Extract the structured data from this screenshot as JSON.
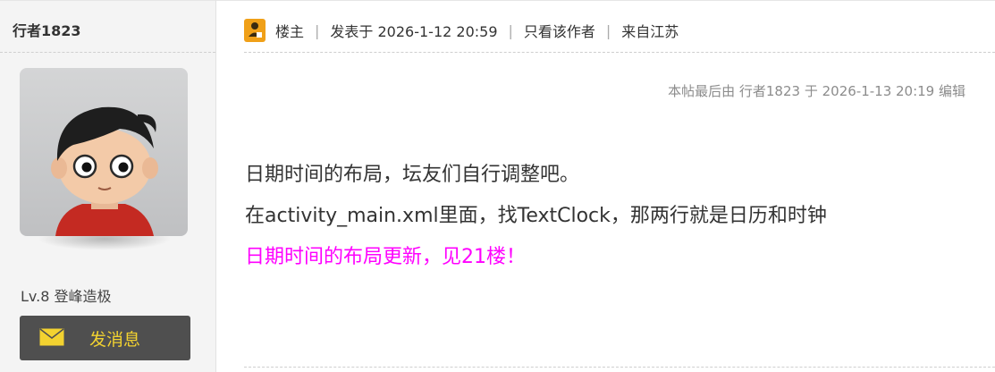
{
  "author": {
    "name": "行者1823",
    "level": "Lv.8 登峰造极",
    "message_button_label": "发消息"
  },
  "post_header": {
    "owner_label": "楼主",
    "separator": "|",
    "posted_at": "发表于 2026-1-12 20:59",
    "only_author_link": "只看该作者",
    "location": "来自江苏"
  },
  "edit_note": "本帖最后由 行者1823 于 2026-1-13 20:19 编辑",
  "content": {
    "line1": "日期时间的布局，坛友们自行调整吧。",
    "line2": "在activity_main.xml里面，找TextClock，那两行就是日历和时钟",
    "line3": "日期时间的布局更新，见21楼！"
  },
  "colors": {
    "highlight_text": "#ff00ff",
    "button_bg": "#4f4f4f",
    "button_text": "#f2d230",
    "owner_icon": "#f0a018"
  },
  "icons": [
    "avatar",
    "owner-badge-icon",
    "envelope-icon"
  ]
}
